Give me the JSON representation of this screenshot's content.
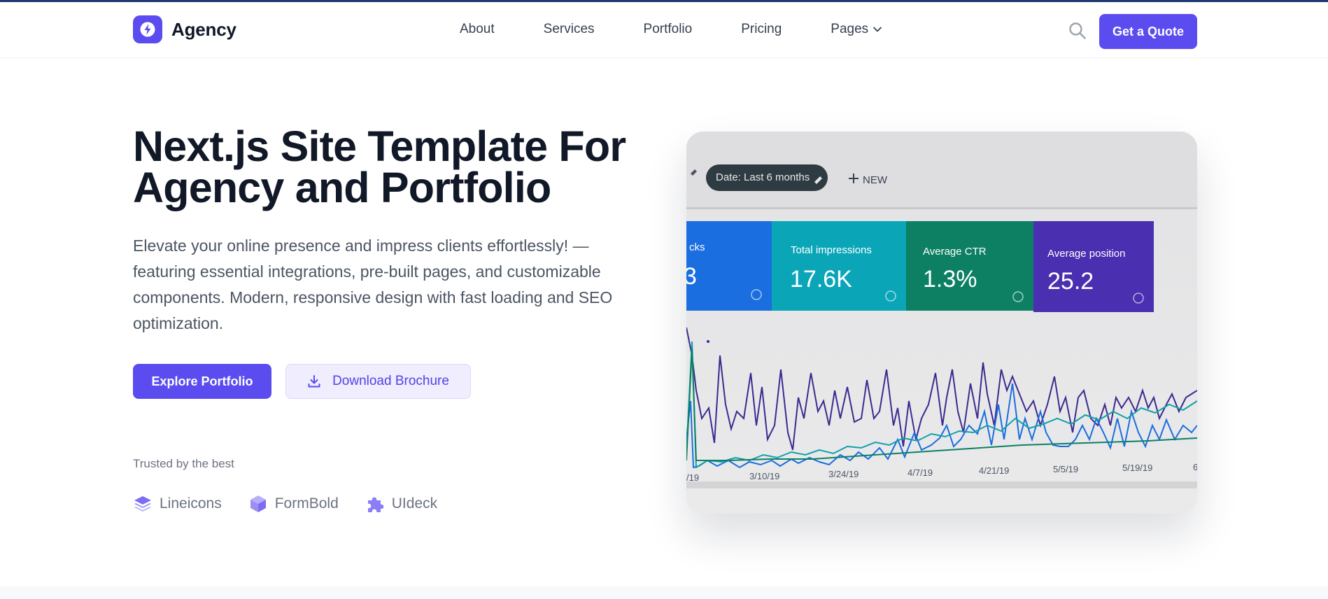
{
  "brand": {
    "name": "Agency",
    "accent": "#5b4cf0"
  },
  "nav": {
    "items": [
      "About",
      "Services",
      "Portfolio",
      "Pricing",
      "Pages"
    ]
  },
  "header": {
    "cta_label": "Get a Quote"
  },
  "hero": {
    "title_line1": "Next.js Site Template For",
    "title_line2": "Agency and Portfolio",
    "description": "Elevate your online presence and impress clients effortlessly! — featuring essential integrations, pre-built pages, and customizable components. Modern, responsive design with fast loading and SEO optimization.",
    "primary_label": "Explore Portfolio",
    "secondary_label": "Download Brochure"
  },
  "trusted": {
    "label": "Trusted by the best",
    "brands": [
      "Lineicons",
      "FormBold",
      "UIdeck"
    ]
  },
  "dashboard": {
    "date_chip": "Date: Last 6 months",
    "new_label": "NEW",
    "metrics": [
      {
        "label": "cks",
        "value": "3"
      },
      {
        "label": "Total impressions",
        "value": "17.6K"
      },
      {
        "label": "Average CTR",
        "value": "1.3%"
      },
      {
        "label": "Average position",
        "value": "25.2"
      }
    ],
    "dates": [
      "/19",
      "3/10/19",
      "3/24/19",
      "4/7/19",
      "4/21/19",
      "5/5/19",
      "5/19/19",
      "6"
    ]
  }
}
